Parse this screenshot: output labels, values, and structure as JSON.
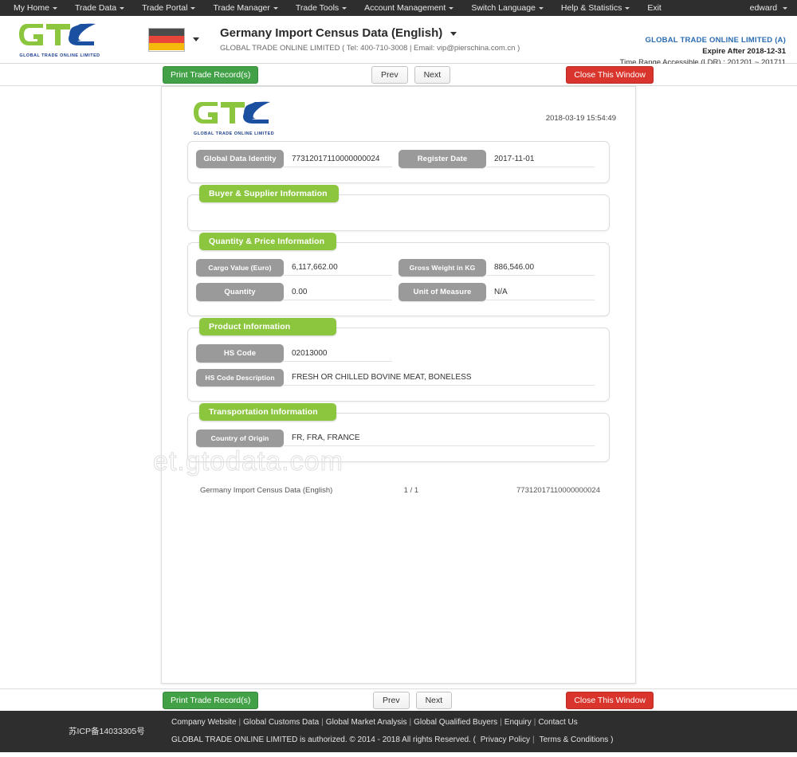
{
  "topnav": {
    "items": [
      {
        "label": "My Home",
        "caret": true
      },
      {
        "label": "Trade Data",
        "caret": true
      },
      {
        "label": "Trade Portal",
        "caret": true
      },
      {
        "label": "Trade Manager",
        "caret": true
      },
      {
        "label": "Trade Tools",
        "caret": true
      },
      {
        "label": "Account Management",
        "caret": true
      },
      {
        "label": "Switch Language",
        "caret": true
      },
      {
        "label": "Help & Statistics",
        "caret": true
      },
      {
        "label": "Exit",
        "caret": false
      }
    ],
    "user": "edward"
  },
  "header": {
    "logo_text": "GTO",
    "logo_sub": "GLOBAL TRADE  ONLINE LIMITED",
    "flag_country": "Germany",
    "title": "Germany Import Census Data (English)",
    "subtitle": "GLOBAL TRADE ONLINE LIMITED ( Tel: 400-710-3008 | Email: vip@pierschina.com.cn )",
    "account_name": "GLOBAL TRADE ONLINE LIMITED (A)",
    "expire": "Expire After 2018-12-31",
    "time_range": "Time Range Accessible (LDR) : 201201 ~ 201711"
  },
  "toolbar": {
    "print_label": "Print Trade Record(s)",
    "prev_label": "Prev",
    "next_label": "Next",
    "close_label": "Close This Window"
  },
  "document": {
    "logo_text": "GTO",
    "logo_sub": "GLOBAL TRADE  ONLINE LIMITED",
    "generated_at": "2018-03-19 15:54:49",
    "watermark": "et.gtodata.com",
    "identity": {
      "id_label": "Global Data Identity",
      "id_value": "77312017110000000024",
      "reg_label": "Register Date",
      "reg_value": "2017-11-01"
    },
    "sections": [
      {
        "title": "Buyer & Supplier Information",
        "fields": []
      },
      {
        "title": "Quantity & Price Information",
        "fields": [
          {
            "label": "Cargo Value (Euro)",
            "value": "6,117,662.00"
          },
          {
            "label": "Gross Weight in KG",
            "value": "886,546.00"
          },
          {
            "label": "Quantity",
            "value": "0.00"
          },
          {
            "label": "Unit of Measure",
            "value": "N/A"
          }
        ]
      },
      {
        "title": "Product Information",
        "fields": [
          {
            "label": "HS Code",
            "value": "02013000",
            "full": false
          },
          {
            "label": "HS Code Description",
            "value": "FRESH OR CHILLED BOVINE MEAT, BONELESS",
            "full": true
          }
        ]
      },
      {
        "title": "Transportation Information",
        "fields": [
          {
            "label": "Country of Origin",
            "value": "FR, FRA, FRANCE",
            "full": true
          }
        ]
      }
    ],
    "footer": {
      "left": "Germany Import Census Data (English)",
      "middle": "1 / 1",
      "right": "77312017110000000024"
    }
  },
  "footer": {
    "icp": "苏ICP备14033305号",
    "links": [
      "Company Website",
      "Global Customs Data",
      "Global Market Analysis",
      "Global Qualified Buyers",
      "Enquiry",
      "Contact Us"
    ],
    "copyright": "GLOBAL TRADE ONLINE LIMITED is authorized. © 2014 - 2018 All rights Reserved.  (",
    "policy_links": [
      "Privacy Policy",
      "Terms & Conditions"
    ],
    "copyright_end": ")"
  },
  "colors": {
    "nav_bg": "#2e2e2e",
    "green": "#8cc63e",
    "btn_green": "#42a147",
    "btn_red": "#d9352c",
    "label_grey": "#9a9a9a",
    "accent_blue": "#2b6cb0"
  }
}
